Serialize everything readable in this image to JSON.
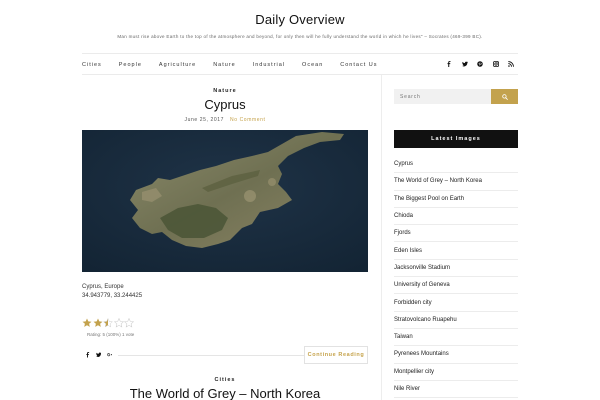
{
  "site": {
    "title": "Daily Overview",
    "tagline": "Man must rise above Earth to the top of the atmosphere and beyond, for only then will he fully understand the world in which he lives\" – Socrates (469-399 BC)."
  },
  "nav": {
    "items": [
      {
        "label": "Cities"
      },
      {
        "label": "People"
      },
      {
        "label": "Agriculture"
      },
      {
        "label": "Nature"
      },
      {
        "label": "Industrial"
      },
      {
        "label": "Ocean"
      },
      {
        "label": "Contact Us"
      }
    ],
    "social_icons": [
      "facebook-icon",
      "twitter-icon",
      "pinterest-icon",
      "instagram-icon",
      "rss-icon"
    ]
  },
  "post": {
    "category": "Nature",
    "title": "Cyprus",
    "date": "June 25, 2017",
    "comments": "No Comment",
    "caption_line1": "Cyprus, Europe",
    "caption_line2": "34.943779, 33.244425",
    "rating": {
      "stars_filled": 2.5,
      "stars_total": 5,
      "text": "Rating: 5 (100%) 1 vote"
    },
    "share_icons": [
      "facebook-icon",
      "twitter-icon",
      "google-plus-icon"
    ],
    "continue_label": "Continue Reading"
  },
  "next_post": {
    "category": "Cities",
    "title": "The World of Grey – North Korea"
  },
  "sidebar": {
    "search_placeholder": "Search",
    "latest_title": "Latest Images",
    "latest_items": [
      {
        "label": "Cyprus"
      },
      {
        "label": "The World of Grey – North Korea"
      },
      {
        "label": "The Biggest Pool on Earth"
      },
      {
        "label": "Chioda"
      },
      {
        "label": "Fjords"
      },
      {
        "label": "Eden Isles"
      },
      {
        "label": "Jacksonville Stadium"
      },
      {
        "label": "University of Geneva"
      },
      {
        "label": "Forbidden city"
      },
      {
        "label": "Stratovolcano Ruapehu"
      },
      {
        "label": "Taiwan"
      },
      {
        "label": "Pyrenees Mountains"
      },
      {
        "label": "Montpellier city"
      },
      {
        "label": "Nile River"
      }
    ]
  },
  "colors": {
    "accent": "#c3a24d",
    "widget_header": "#111111"
  }
}
